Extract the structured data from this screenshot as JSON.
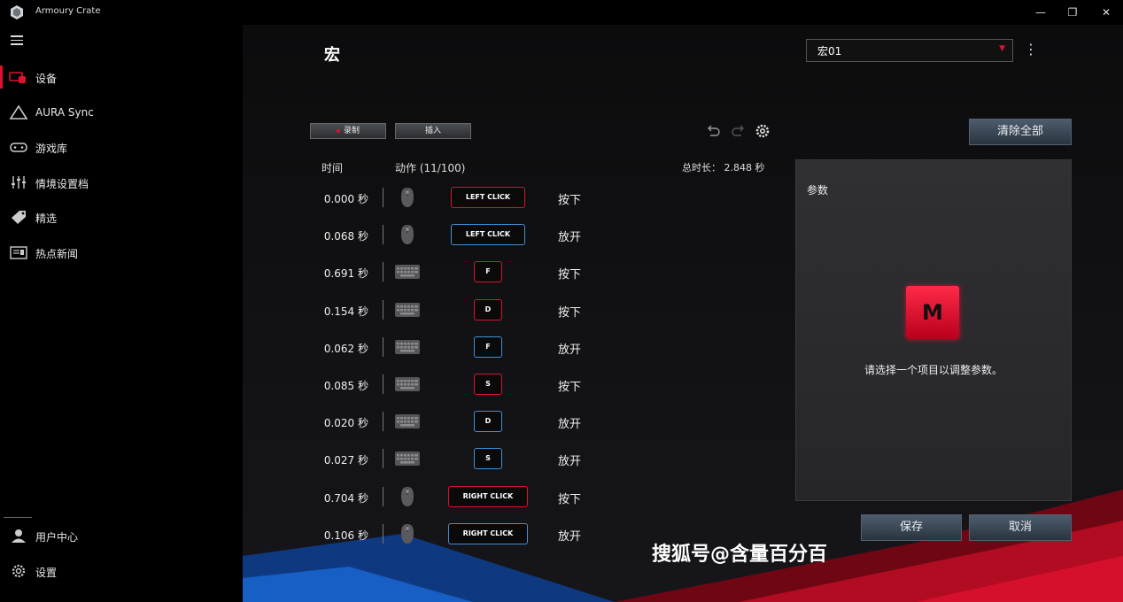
{
  "app": {
    "title": "Armoury Crate",
    "minimize": "—",
    "maximize": "❐",
    "close": "✕"
  },
  "sidebar": {
    "items": [
      {
        "label": "设备",
        "icon": "device-icon",
        "active": true
      },
      {
        "label": "AURA Sync",
        "icon": "aura-sync-icon"
      },
      {
        "label": "游戏库",
        "icon": "game-library-icon"
      },
      {
        "label": "情境设置档",
        "icon": "scenario-profile-icon"
      },
      {
        "label": "精选",
        "icon": "featured-icon"
      },
      {
        "label": "热点新闻",
        "icon": "news-icon"
      }
    ],
    "bottom": [
      {
        "label": "用户中心",
        "icon": "user-icon"
      },
      {
        "label": "设置",
        "icon": "gear-icon"
      }
    ]
  },
  "page": {
    "title": "宏",
    "profile_select": "宏01",
    "record_label": "录制",
    "insert_label": "插入",
    "clear_all_label": "清除全部",
    "col_time": "时间",
    "col_action": "动作 (11/100)",
    "total_duration": "总时长： 2.848 秒",
    "save_label": "保存",
    "cancel_label": "取消"
  },
  "macro_rows": [
    {
      "time": "0.000 秒",
      "device": "mouse",
      "key": "LEFT CLICK",
      "state": "按下",
      "type": "press"
    },
    {
      "time": "0.068 秒",
      "device": "mouse",
      "key": "LEFT CLICK",
      "state": "放开",
      "type": "release"
    },
    {
      "time": "0.691 秒",
      "device": "keyboard",
      "key": "F",
      "state": "按下",
      "type": "press"
    },
    {
      "time": "0.154 秒",
      "device": "keyboard",
      "key": "D",
      "state": "按下",
      "type": "press"
    },
    {
      "time": "0.062 秒",
      "device": "keyboard",
      "key": "F",
      "state": "放开",
      "type": "release"
    },
    {
      "time": "0.085 秒",
      "device": "keyboard",
      "key": "S",
      "state": "按下",
      "type": "press"
    },
    {
      "time": "0.020 秒",
      "device": "keyboard",
      "key": "D",
      "state": "放开",
      "type": "release"
    },
    {
      "time": "0.027 秒",
      "device": "keyboard",
      "key": "S",
      "state": "放开",
      "type": "release"
    },
    {
      "time": "0.704 秒",
      "device": "mouse",
      "key": "RIGHT CLICK",
      "state": "按下",
      "type": "press"
    },
    {
      "time": "0.106 秒",
      "device": "mouse",
      "key": "RIGHT CLICK",
      "state": "放开",
      "type": "release"
    }
  ],
  "params_panel": {
    "title": "参数",
    "badge": "M",
    "hint": "请选择一个项目以调整参数。"
  },
  "watermark": "搜狐号@含量百分百",
  "colors": {
    "accent_red": "#e0102f",
    "release_blue": "#3f8fd8",
    "button_steel": "#3e4c5b"
  }
}
